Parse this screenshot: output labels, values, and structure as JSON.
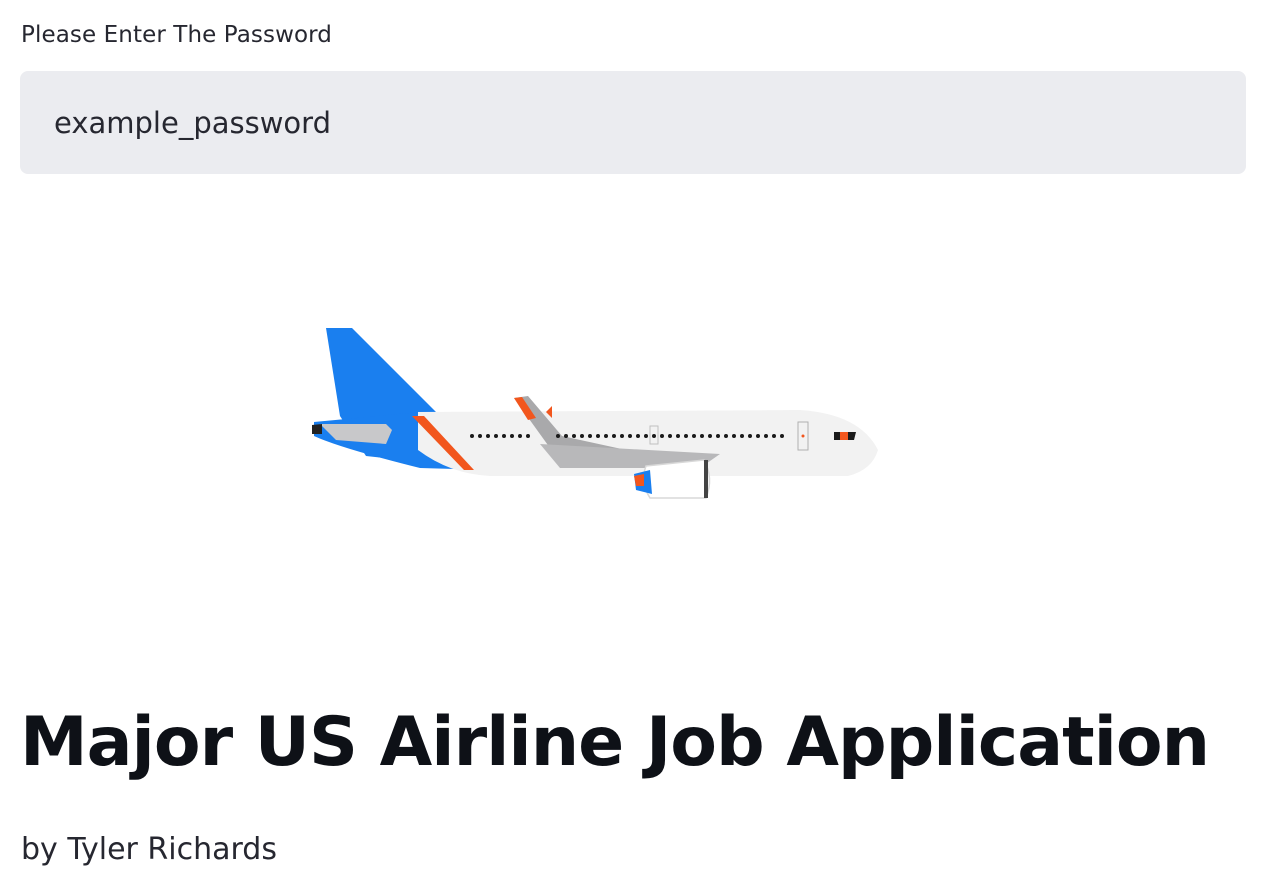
{
  "password": {
    "label": "Please Enter The Password",
    "value": "example_password",
    "field_type": "text"
  },
  "hero": {
    "image_name": "airplane-illustration",
    "colors": {
      "tail": "#1a7fef",
      "stripe": "#f2561d",
      "fuselage": "#f2f2f2",
      "wing": "#a9a9ab"
    }
  },
  "header": {
    "title": "Major US Airline Job Application",
    "byline": "by Tyler Richards"
  }
}
